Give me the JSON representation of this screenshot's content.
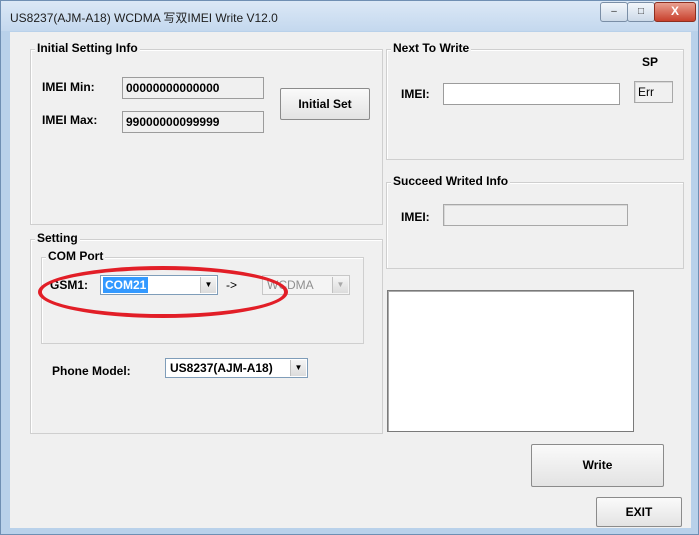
{
  "window": {
    "title": "US8237(AJM-A18) WCDMA 写双IMEI Write V12.0",
    "controls": {
      "minimize": "–",
      "maximize": "□",
      "close": "X"
    }
  },
  "initial_setting": {
    "group_label": "Initial Setting Info",
    "imei_min_label": "IMEI Min:",
    "imei_min_value": "00000000000000",
    "imei_max_label": "IMEI Max:",
    "imei_max_value": "99000000099999",
    "initial_set_button": "Initial Set"
  },
  "setting": {
    "group_label": "Setting",
    "com_port": {
      "group_label": "COM Port",
      "gsm1_label": "GSM1:",
      "gsm1_value": "COM21",
      "arrow": "->",
      "mode_value": "WCDMA"
    },
    "phone_model_label": "Phone Model:",
    "phone_model_value": "US8237(AJM-A18)"
  },
  "next_to_write": {
    "group_label": "Next To Write",
    "sp_label": "SP",
    "imei_label": "IMEI:",
    "imei_value": "",
    "err_value": "Err"
  },
  "succeed": {
    "group_label": "Succeed Writed Info",
    "imei_label": "IMEI:",
    "imei_value": ""
  },
  "buttons": {
    "write": "Write",
    "exit": "EXIT"
  },
  "colors": {
    "titlebar": "#c4d8ee",
    "dialog_bg": "#f0f0f0",
    "selection": "#3399ff",
    "annotation_red": "#e21e27"
  }
}
